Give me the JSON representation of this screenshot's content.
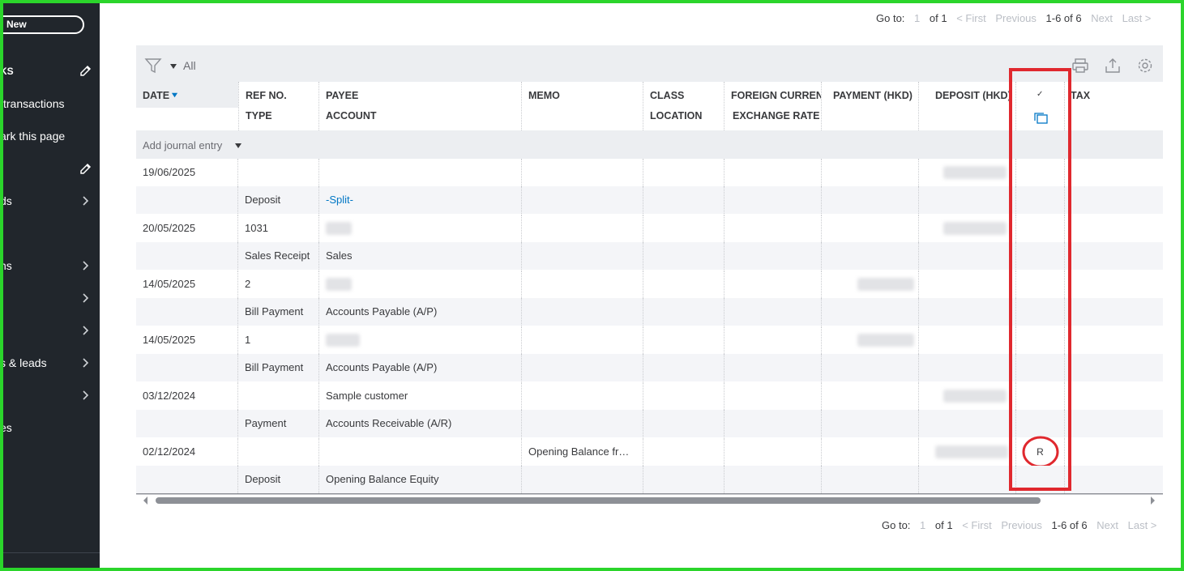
{
  "sidebar": {
    "new_label": "New",
    "items": [
      {
        "label": "KS",
        "icon": "pencil-icon"
      },
      {
        "label": "transactions",
        "icon": ""
      },
      {
        "label": "ark this page",
        "icon": ""
      },
      {
        "label": "",
        "icon": "pencil-icon"
      },
      {
        "label": "ds",
        "icon": "chevron-right-icon"
      },
      {
        "label": "ns",
        "icon": "chevron-right-icon"
      },
      {
        "label": "",
        "icon": "chevron-right-icon"
      },
      {
        "label": "",
        "icon": "chevron-right-icon"
      },
      {
        "label": "s & leads",
        "icon": "chevron-right-icon"
      },
      {
        "label": "",
        "icon": "chevron-right-icon"
      },
      {
        "label": "es",
        "icon": ""
      }
    ]
  },
  "pager_top": {
    "goto_label": "Go to:",
    "page_input": "1",
    "of_label": "of 1",
    "first": "< First",
    "previous": "Previous",
    "range": "1-6 of 6",
    "next": "Next",
    "last": "Last >"
  },
  "pager_bottom": {
    "goto_label": "Go to:",
    "page_input": "1",
    "of_label": "of 1",
    "first": "< First",
    "previous": "Previous",
    "range": "1-6 of 6",
    "next": "Next",
    "last": "Last >"
  },
  "toolbar": {
    "filter_value": "All"
  },
  "columns": {
    "date": "DATE",
    "ref_no": "REF NO.",
    "type": "TYPE",
    "payee": "PAYEE",
    "account": "ACCOUNT",
    "memo": "MEMO",
    "class": "CLASS",
    "location": "LOCATION",
    "foreign_currency": "FOREIGN CURRENC",
    "exchange_rate": "EXCHANGE RATE",
    "payment": "PAYMENT (HKD)",
    "deposit": "DEPOSIT (HKD)",
    "check": "✓",
    "tax": "TAX"
  },
  "add_row": {
    "label": "Add journal entry"
  },
  "transactions": [
    {
      "date": "19/06/2025",
      "ref": "",
      "type": "Deposit",
      "payee": "",
      "account": "-Split-",
      "memo": "",
      "reconciled": ""
    },
    {
      "date": "20/05/2025",
      "ref": "1031",
      "type": "Sales Receipt",
      "payee": "",
      "account": "Sales",
      "memo": "",
      "reconciled": ""
    },
    {
      "date": "14/05/2025",
      "ref": "2",
      "type": "Bill Payment",
      "payee": "",
      "account": "Accounts Payable (A/P)",
      "memo": "",
      "reconciled": ""
    },
    {
      "date": "14/05/2025",
      "ref": "1",
      "type": "Bill Payment",
      "payee": "",
      "account": "Accounts Payable (A/P)",
      "memo": "",
      "reconciled": ""
    },
    {
      "date": "03/12/2024",
      "ref": "",
      "type": "Payment",
      "payee": "Sample customer",
      "account": "Accounts Receivable (A/R)",
      "memo": "",
      "reconciled": ""
    },
    {
      "date": "02/12/2024",
      "ref": "",
      "type": "Deposit",
      "payee": "",
      "account": "Opening Balance Equity",
      "memo": "Opening Balance fr…",
      "reconciled": "R"
    }
  ],
  "colors": {
    "sidebar_bg": "#21262c",
    "link": "#0077c5",
    "highlight_green": "#2bd52b",
    "highlight_red": "#e0282e"
  }
}
